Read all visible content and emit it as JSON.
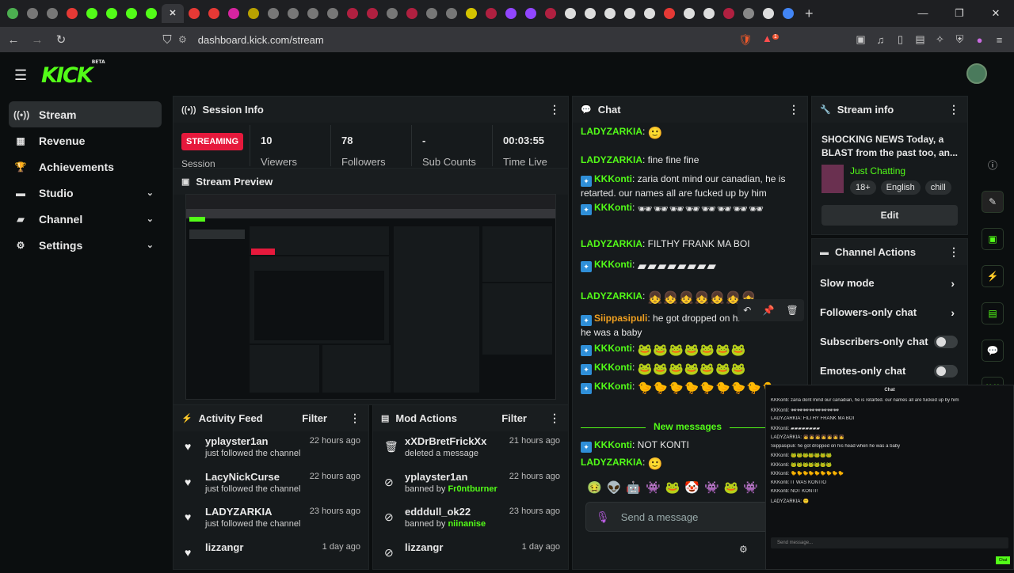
{
  "browser": {
    "tabs": [
      {
        "icon": "chrome-extension-icon",
        "color": "#4caf50"
      },
      {
        "icon": "chrome-extension-icon",
        "color": "#777"
      },
      {
        "icon": "chrome-extension-icon",
        "color": "#777"
      },
      {
        "icon": "youtube-icon",
        "color": "#e53935"
      },
      {
        "icon": "kick-icon",
        "color": "#53fc18"
      },
      {
        "icon": "kick-icon",
        "color": "#53fc18"
      },
      {
        "icon": "kick-icon",
        "color": "#53fc18"
      },
      {
        "icon": "kick-icon",
        "color": "#53fc18"
      },
      {
        "icon": "close-icon",
        "color": "#ddd",
        "active": true
      },
      {
        "icon": "youtube-icon",
        "color": "#e53935"
      },
      {
        "icon": "youtube-icon",
        "color": "#e53935"
      },
      {
        "icon": "instagram-icon",
        "color": "#d6249f"
      },
      {
        "icon": "generic-tab-icon",
        "color": "#b8a100"
      },
      {
        "icon": "generic-tab-icon",
        "color": "#777"
      },
      {
        "icon": "generic-tab-icon",
        "color": "#777"
      },
      {
        "icon": "generic-tab-icon",
        "color": "#777"
      },
      {
        "icon": "generic-tab-icon",
        "color": "#777"
      },
      {
        "icon": "generic-tab-icon",
        "color": "#b02040"
      },
      {
        "icon": "generic-tab-icon",
        "color": "#b02040"
      },
      {
        "icon": "generic-tab-icon",
        "color": "#777"
      },
      {
        "icon": "generic-tab-icon",
        "color": "#b02040"
      },
      {
        "icon": "generic-tab-icon",
        "color": "#777"
      },
      {
        "icon": "generic-tab-icon",
        "color": "#777"
      },
      {
        "icon": "generic-tab-icon",
        "color": "#d4c400"
      },
      {
        "icon": "generic-tab-icon",
        "color": "#b02040"
      },
      {
        "icon": "twitch-icon",
        "color": "#9146ff"
      },
      {
        "icon": "twitch-icon",
        "color": "#9146ff"
      },
      {
        "icon": "generic-tab-icon",
        "color": "#b02040"
      },
      {
        "icon": "x-icon",
        "color": "#ddd"
      },
      {
        "icon": "x-icon",
        "color": "#ddd"
      },
      {
        "icon": "x-icon",
        "color": "#ddd"
      },
      {
        "icon": "x-icon",
        "color": "#ddd"
      },
      {
        "icon": "x-icon",
        "color": "#ddd"
      },
      {
        "icon": "youtube-icon",
        "color": "#e53935"
      },
      {
        "icon": "x-icon",
        "color": "#ddd"
      },
      {
        "icon": "x-icon",
        "color": "#ddd"
      },
      {
        "icon": "generic-tab-icon",
        "color": "#b02040"
      },
      {
        "icon": "x-icon",
        "color": "#888"
      },
      {
        "icon": "x-icon",
        "color": "#ddd"
      },
      {
        "icon": "google-icon",
        "color": "#4285f4"
      }
    ],
    "url": "dashboard.kick.com/stream",
    "brave_badge": "1"
  },
  "app": {
    "logo": "KICK",
    "logo_sup": "BETA",
    "sidebar": [
      {
        "label": "Stream",
        "icon": "stream-icon",
        "active": true
      },
      {
        "label": "Revenue",
        "icon": "revenue-icon"
      },
      {
        "label": "Achievements",
        "icon": "trophy-icon"
      },
      {
        "label": "Studio",
        "icon": "studio-icon",
        "chevron": true
      },
      {
        "label": "Channel",
        "icon": "channel-icon",
        "chevron": true
      },
      {
        "label": "Settings",
        "icon": "gear-icon",
        "chevron": true
      }
    ]
  },
  "session": {
    "title": "Session Info",
    "status": "STREAMING",
    "status_sub": "Session",
    "stats": [
      {
        "value": "10",
        "label": "Viewers"
      },
      {
        "value": "78",
        "label": "Followers"
      },
      {
        "value": "-",
        "label": "Sub Counts"
      },
      {
        "value": "00:03:55",
        "label": "Time Live"
      }
    ]
  },
  "preview": {
    "title": "Stream Preview"
  },
  "activity": {
    "title": "Activity Feed",
    "filter": "Filter",
    "items": [
      {
        "name": "yplayster1an",
        "sub": "just followed the channel",
        "time": "22 hours ago"
      },
      {
        "name": "LacyNickCurse",
        "sub": "just followed the channel",
        "time": "22 hours ago"
      },
      {
        "name": "LADYZARKIA",
        "sub": "just followed the channel",
        "time": "23 hours ago"
      },
      {
        "name": "lizzangr",
        "sub": "",
        "time": "1 day ago"
      }
    ]
  },
  "mod": {
    "title": "Mod Actions",
    "filter": "Filter",
    "items": [
      {
        "name": "xXDrBretFrickXx",
        "sub": "deleted a message",
        "by": "",
        "time": "21 hours ago",
        "icon": "trash-icon"
      },
      {
        "name": "yplayster1an",
        "sub": "banned by ",
        "by": "Fr0ntburner",
        "time": "22 hours ago",
        "icon": "ban-icon"
      },
      {
        "name": "edddull_ok22",
        "sub": "banned by ",
        "by": "niinanise",
        "time": "23 hours ago",
        "icon": "ban-icon"
      },
      {
        "name": "lizzangr",
        "sub": "",
        "by": "",
        "time": "1 day ago",
        "icon": "ban-icon"
      }
    ]
  },
  "chat": {
    "title": "Chat",
    "messages": [
      {
        "user": "LADYZARKIA",
        "badge": false,
        "text": "",
        "emote": "🙂"
      },
      {
        "user": "LADYZARKIA",
        "badge": false,
        "text": "fine fine fine",
        "emote": ""
      },
      {
        "user": "KKKonti",
        "badge": true,
        "text": "zaria dont mind our canadian, he is retarted. our names all are fucked up by him",
        "emote": ""
      },
      {
        "user": "KKKonti",
        "badge": true,
        "text": "",
        "emote": "🕶🕶🕶🕶🕶🕶🕶🕶"
      },
      {
        "user": "LADYZARKIA",
        "badge": false,
        "text": "FILTHY FRANK MA BOI",
        "emote": ""
      },
      {
        "user": "KKKonti",
        "badge": true,
        "text": "",
        "emote": "▰▰▰▰▰▰▰▰"
      },
      {
        "user": "LADYZARKIA",
        "badge": false,
        "text": "",
        "emote": "👧👧👧👧👧👧👧"
      },
      {
        "user": "Siippasipuli",
        "badge": true,
        "text": "he got dropped on his head when he was a baby",
        "emote": "",
        "orange": true
      },
      {
        "user": "KKKonti",
        "badge": true,
        "text": "",
        "emote": "🐸🐸🐸🐸🐸🐸🐸"
      },
      {
        "user": "KKKonti",
        "badge": true,
        "text": "",
        "emote": "🐸🐸🐸🐸🐸🐸🐸"
      },
      {
        "user": "KKKonti",
        "badge": true,
        "text": "",
        "emote": "🐤🐤🐤🐤🐤🐤🐤🐤🐤"
      }
    ],
    "new_messages": "New messages",
    "after": [
      {
        "user": "KKKonti",
        "badge": true,
        "text": "NOT KONTI",
        "emote": ""
      },
      {
        "user": "LADYZARKIA",
        "badge": false,
        "text": "",
        "emote": "🙂"
      }
    ],
    "emote_bar": "🤢👽🤖👾🐸🤡👾🐸👾",
    "send_placeholder": "Send a message"
  },
  "streaminfo": {
    "title": "Stream info",
    "stream_title": "SHOCKING NEWS Today, a BLAST from the past too, an...",
    "category": "Just Chatting",
    "tags": [
      "18+",
      "English",
      "chill"
    ],
    "edit": "Edit"
  },
  "actions": {
    "title": "Channel Actions",
    "rows": [
      {
        "label": "Slow mode",
        "type": "arrow"
      },
      {
        "label": "Followers-only chat",
        "type": "arrow"
      },
      {
        "label": "Subscribers-only chat",
        "type": "toggle"
      },
      {
        "label": "Emotes-only chat",
        "type": "toggle"
      }
    ]
  },
  "popout": {
    "title": "Chat",
    "lines": [
      "KKKonti: zaria dont mind our canadian, he is retarted. our names all are fucked up by him",
      "KKKonti: 🕶🕶🕶🕶🕶🕶🕶🕶",
      "LADYZARKIA: FILTHY FRANK MA BOI",
      "KKKonti: ▰▰▰▰▰▰▰▰",
      "LADYZARKIA: 👧👧👧👧👧👧👧",
      "Siippasipuli: he got dropped on his head when he was a baby",
      "KKKonti: 🐸🐸🐸🐸🐸🐸🐸",
      "KKKonti: 🐸🐸🐸🐸🐸🐸🐸",
      "KKKonti: 🐤🐤🐤🐤🐤🐤🐤🐤🐤",
      "KKKonti: IT WAS KONTIO",
      "KKKonti: NOT KONTI!",
      "LADYZARKIA: 🙂"
    ],
    "send": "Send message...",
    "chat_btn": "Chat"
  }
}
